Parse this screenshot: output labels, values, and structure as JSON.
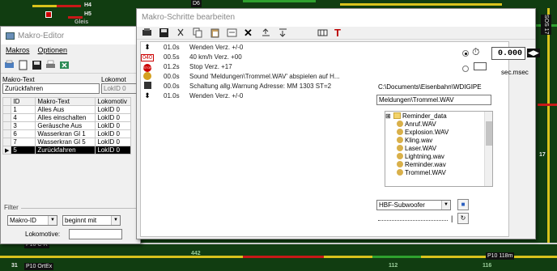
{
  "background": {
    "labels": [
      "H4",
      "H5",
      "Gleis",
      "D6",
      "P10 118m",
      "P10 OrtEx",
      "31",
      "P16 C-R",
      "442",
      "112",
      "116",
      "17",
      "SOS 17"
    ]
  },
  "editor": {
    "title": "Makro-Editor",
    "menu": [
      "Makros",
      "Optionen"
    ],
    "makro_text_label": "Makro-Text",
    "lokomotive_label": "Lokomot",
    "makro_text_value": "Zurückfahren",
    "lokid_value": "LokID 0",
    "table": {
      "headers": [
        "ID",
        "Makro-Text",
        "Lokomotiv"
      ],
      "rows": [
        {
          "id": "1",
          "text": "Alles Aus",
          "lok": "LokID 0"
        },
        {
          "id": "4",
          "text": "Alles einschalten",
          "lok": "LokID 0"
        },
        {
          "id": "3",
          "text": "Geräusche Aus",
          "lok": "LokID 0"
        },
        {
          "id": "6",
          "text": "Wasserkran Gl 1",
          "lok": "LokID 0"
        },
        {
          "id": "7",
          "text": "Wasserkran Gl 5",
          "lok": "LokID 0"
        },
        {
          "id": "5",
          "text": "Zurückfahren",
          "lok": "LokID 0"
        }
      ],
      "selected_id": "5"
    },
    "filter": {
      "label": "Filter",
      "field": "Makro-ID",
      "mode": "beginnt mit",
      "lok_label": "Lokomotive:",
      "lok_value": ""
    }
  },
  "steps": {
    "title": "Makro-Schritte bearbeiten",
    "items": [
      {
        "icon": "up-down-arrow-icon",
        "time": "01.0s",
        "desc": "Wenden Verz. +/-0"
      },
      {
        "icon": "speed-040-icon",
        "badge": "040",
        "time": "00.5s",
        "desc": "40 km/h Verz. +00"
      },
      {
        "icon": "stop-icon",
        "badge": "STOP",
        "time": "01.2s",
        "desc": "Stop Verz. +17"
      },
      {
        "icon": "sound-icon",
        "time": "00.0s",
        "desc": "Sound 'Meldungen\\Trommel.WAV' abspielen auf H..."
      },
      {
        "icon": "switch-square-icon",
        "time": "00.0s",
        "desc": "Schaltung allg.Warnung Adresse: MM 1303 ST=2"
      },
      {
        "icon": "up-down-arrow-icon",
        "time": "01.0s",
        "desc": "Wenden Verz. +/-0"
      }
    ],
    "delay": {
      "value": "0.000",
      "unit": "sec.msec"
    },
    "path": "C:\\Documents\\Eisenbahn\\WDIGIPE",
    "folder": "Meldungen\\Trommel.WAV",
    "tree": [
      {
        "name": "Reminder_data",
        "kind": "folder",
        "expander": "⊞"
      },
      {
        "name": "Anruf.WAV",
        "kind": "wav"
      },
      {
        "name": "Explosion.WAV",
        "kind": "wav"
      },
      {
        "name": "Kling.wav",
        "kind": "wav"
      },
      {
        "name": "Laser.WAV",
        "kind": "wav"
      },
      {
        "name": "Lightning.wav",
        "kind": "wav"
      },
      {
        "name": "Reminder.wav",
        "kind": "wav"
      },
      {
        "name": "Trommel.WAV",
        "kind": "wav"
      }
    ],
    "output_device": "HBF-Subwoofer"
  }
}
